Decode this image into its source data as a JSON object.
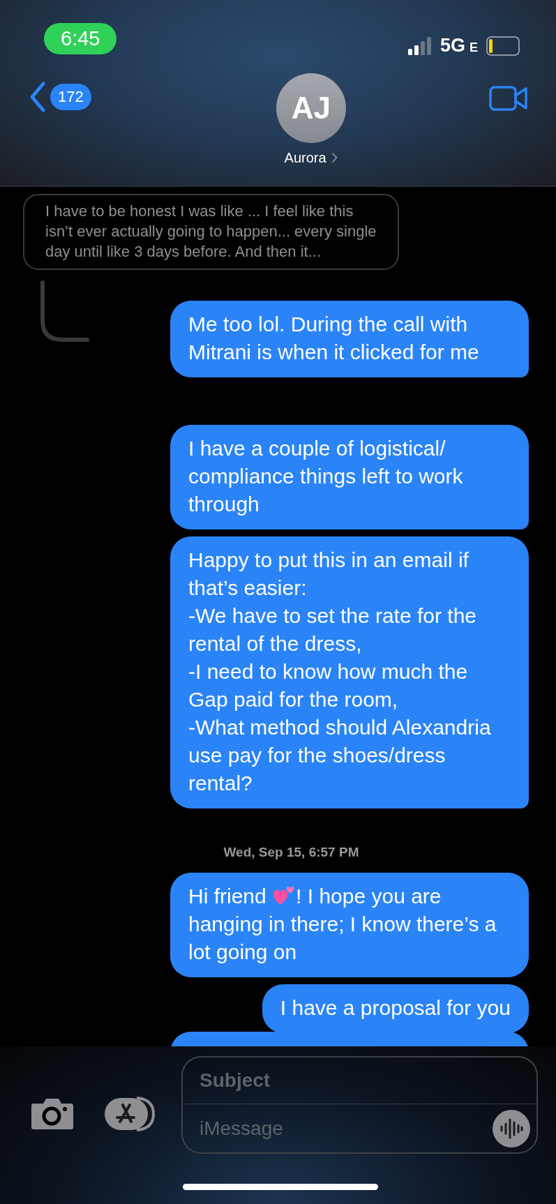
{
  "status_bar": {
    "time": "6:45",
    "network": "5G",
    "network_suffix": "E"
  },
  "header": {
    "back_count": "172",
    "avatar_initials": "AJ",
    "contact_name": "Aurora"
  },
  "quoted_message": {
    "text": "I have to be honest I was like ... I feel like this isn’t ever actually going to happen... every single day until like 3 days before. And then it..."
  },
  "groups": [
    {
      "messages": [
        {
          "text": "Me too lol. During the call with Mitrani is when it clicked for me",
          "tail": true
        }
      ]
    },
    {
      "messages": [
        {
          "text": "I have a couple of logistical/ compliance things left to work through",
          "tail": true
        },
        {
          "text": "Happy to put this in an email if that’s easier:\n-We have to set the rate for the rental of the dress,\n-I need to know how much the Gap paid for the room,\n-What method should Alexandria use pay for the shoes/dress rental?",
          "tail": true
        }
      ]
    },
    {
      "timestamp": "Wed, Sep 15, 6:57 PM",
      "messages": [
        {
          "text": "Hi friend",
          "emoji": true,
          "text_after": "! I hope you are hanging in there; I know there’s a lot going on",
          "tail": false
        },
        {
          "text": "I have a proposal for you",
          "tail": false
        }
      ]
    }
  ],
  "compose": {
    "subject_placeholder": "Subject",
    "message_placeholder": "iMessage"
  }
}
